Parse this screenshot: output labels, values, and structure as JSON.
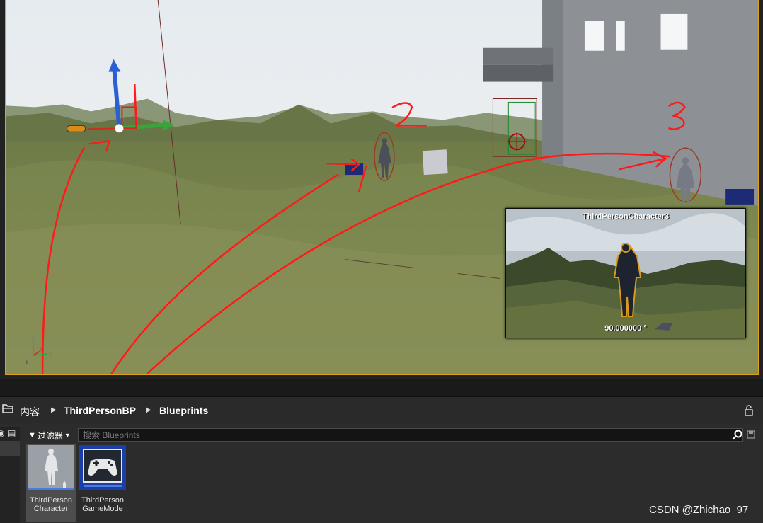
{
  "viewport": {
    "preview": {
      "title": "ThirdPersonCharacter3",
      "angle": "90.000000 °"
    },
    "annotations": [
      "1",
      "2",
      "3"
    ]
  },
  "content_browser": {
    "breadcrumb": [
      "内容",
      "ThirdPersonBP",
      "Blueprints"
    ],
    "filter_label": "过滤器",
    "search_placeholder": "搜索 Blueprints",
    "assets": [
      {
        "line1": "ThirdPerson",
        "line2": "Character",
        "icon": "mannequin-icon",
        "selected": true
      },
      {
        "line1": "ThirdPerson",
        "line2": "GameMode",
        "icon": "gamepad-icon",
        "selected": false
      }
    ]
  },
  "watermark": "CSDN @Zhichao_97",
  "colors": {
    "selection_frame": "#d9a21a",
    "annotation": "#ff1a1a",
    "sky": "#dfe6ec",
    "terrain": "#6e7d44"
  }
}
